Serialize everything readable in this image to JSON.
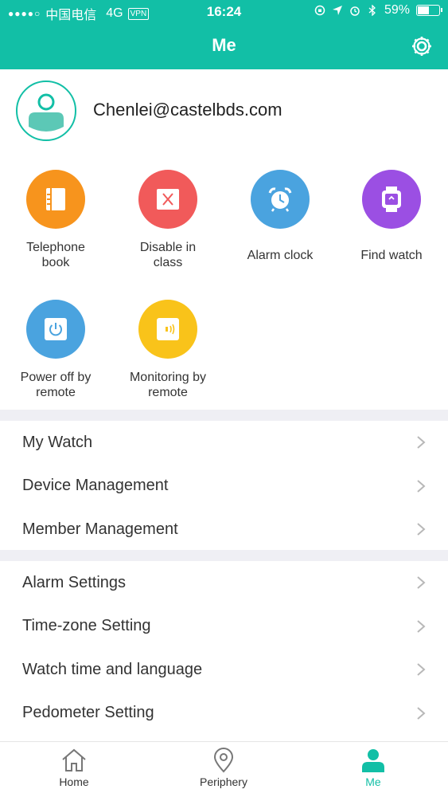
{
  "status_bar": {
    "signal_dots": "●●●●○",
    "carrier": "中国电信",
    "network": "4G",
    "vpn": "VPN",
    "time": "16:24",
    "battery": "59%",
    "battery_level": 0.59
  },
  "header": {
    "title": "Me"
  },
  "profile": {
    "email": "Chenlei@castelbds.com"
  },
  "features": [
    {
      "label": "Telephone book",
      "color": "#f7941d",
      "icon": "book-icon"
    },
    {
      "label": "Disable in class",
      "color": "#f15a5a",
      "icon": "disable-icon"
    },
    {
      "label": "Alarm clock",
      "color": "#4aa3df",
      "icon": "alarm-icon"
    },
    {
      "label": "Find watch",
      "color": "#9b4fe3",
      "icon": "watch-icon"
    },
    {
      "label": "Power off by remote",
      "color": "#4aa3df",
      "icon": "power-icon"
    },
    {
      "label": "Monitoring by remote",
      "color": "#f9c31a",
      "icon": "monitor-icon"
    }
  ],
  "menu_group_1": [
    {
      "label": "My Watch"
    },
    {
      "label": "Device Management"
    },
    {
      "label": "Member Management"
    }
  ],
  "menu_group_2": [
    {
      "label": "Alarm Settings"
    },
    {
      "label": "Time-zone Setting"
    },
    {
      "label": "Watch time and language"
    },
    {
      "label": "Pedometer Setting"
    }
  ],
  "tabbar": {
    "home": "Home",
    "periphery": "Periphery",
    "me": "Me"
  },
  "colors": {
    "accent": "#12bfa6",
    "separator": "#efeff4"
  }
}
